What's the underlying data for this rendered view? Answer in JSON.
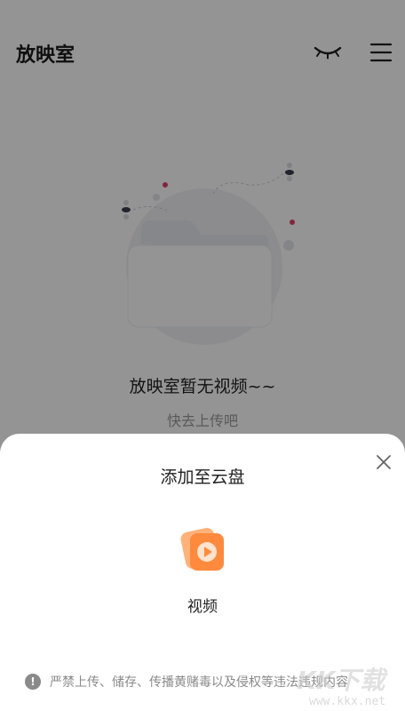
{
  "header": {
    "title": "放映室",
    "eye_icon": "eye-closed-icon",
    "menu_icon": "menu-icon"
  },
  "empty_state": {
    "title": "放映室暂无视频~~",
    "subtitle": "快去上传吧",
    "illustration": "empty-folder-illustration"
  },
  "sheet": {
    "title": "添加至云盘",
    "close_icon": "close-icon",
    "options": [
      {
        "label": "视频",
        "icon": "video-play-icon"
      }
    ],
    "notice_icon": "exclamation-icon",
    "notice": "严禁上传、储存、传播黄赌毒以及侵权等违法违规内容"
  },
  "watermark": {
    "text": "KK下载",
    "url": "www.kkx.net"
  },
  "colors": {
    "accent": "#ff8a3d",
    "overlay": "rgba(0,0,0,0.42)",
    "notice": "#8a8a8a"
  }
}
